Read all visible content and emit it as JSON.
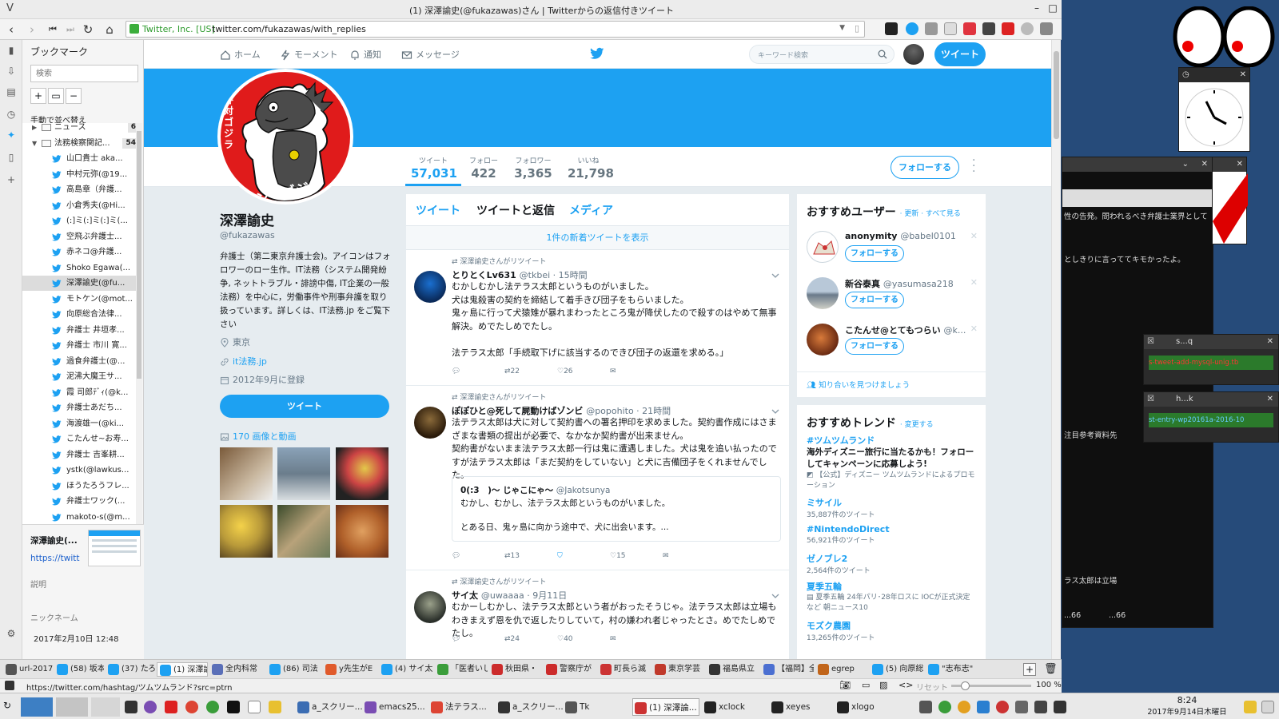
{
  "window": {
    "title": "(1) 深澤諭史(@fukazawas)さん | Twitterからの返信付きツイート",
    "menu_glyph": "V",
    "controls": {
      "minimize": "–",
      "maximize": "□",
      "close": "✕"
    }
  },
  "navbar": {
    "security_label": "Twitter, Inc. [US]",
    "url": "twitter.com/fukazawas/with_replies"
  },
  "sidebar": {
    "title": "ブックマーク",
    "search_placeholder": "検索",
    "sort_label": "手動で並べ替え",
    "tree": [
      {
        "label": "ニュース",
        "count": "6",
        "type": "folder",
        "expanded": false
      },
      {
        "label": "法務検察関記...",
        "count": "54",
        "type": "folder",
        "expanded": true
      },
      {
        "label": "山口貴士 aka..."
      },
      {
        "label": "中村元弥(@19..."
      },
      {
        "label": "高島章（弁護..."
      },
      {
        "label": "小倉秀夫(@Hi..."
      },
      {
        "label": "(:]ミ(:]ミ(:]ミ(..."
      },
      {
        "label": "空飛ぶ弁護士..."
      },
      {
        "label": "赤ネコ@弁護..."
      },
      {
        "label": "Shoko Egawa(..."
      },
      {
        "label": "深澤諭史(@fu...",
        "selected": true
      },
      {
        "label": "モトケン(@mot..."
      },
      {
        "label": "向原総合法律..."
      },
      {
        "label": "弁護士 井垣孝..."
      },
      {
        "label": "弁護士 市川 寛..."
      },
      {
        "label": "過食弁護士(@..."
      },
      {
        "label": "泥沸大魔王サ..."
      },
      {
        "label": "霞 司郎ﾃﾞｨ(@k..."
      },
      {
        "label": "弁護士あだち..."
      },
      {
        "label": "海渡雄一(@ki..."
      },
      {
        "label": "こたんせ~お寿..."
      },
      {
        "label": "弁護士 吉峯耕..."
      },
      {
        "label": "ystk(@lawkus..."
      },
      {
        "label": "ほうたろうフレ..."
      },
      {
        "label": "弁護士ワック(..."
      },
      {
        "label": "makoto-s(@m..."
      }
    ],
    "detail": {
      "name": "深澤諭史(...",
      "url": "https://twitt",
      "desc_label": "説明",
      "nick_label": "ニックネーム",
      "date": "2017年2月10日 12:48"
    }
  },
  "twitter_nav": {
    "home": "ホーム",
    "moments": "モーメント",
    "notifications": "通知",
    "messages": "メッセージ",
    "search_placeholder": "キーワード検索",
    "tweet_button": "ツイート"
  },
  "profile": {
    "avatar_text_vertical": "弁対ゴジラ",
    "avatar_text_bottom": "ベン・ゴジラ",
    "name": "深澤諭史",
    "handle": "@fukazawas",
    "bio": "弁護士（第二東京弁護士会)。アイコンはフォロワーのロー生作。IT法務（システム開発紛争, ネットトラブル・誹謗中傷, IT企業の一般法務）を中心に，労働事件や刑事弁護を取り扱っています。詳しくは、IT法務.jp をご覧下さい",
    "location": "東京",
    "website": "it法務.jp",
    "joined": "2012年9月に登録",
    "tweet_button": "ツイート",
    "media_link": "170 画像と動画",
    "stats": [
      {
        "label": "ツイート",
        "value": "57,031",
        "active": true
      },
      {
        "label": "フォロー",
        "value": "422"
      },
      {
        "label": "フォロワー",
        "value": "3,365"
      },
      {
        "label": "いいね",
        "value": "21,798"
      }
    ],
    "follow_button": "フォローする"
  },
  "timeline": {
    "tabs": [
      "ツイート",
      "ツイートと返信",
      "メディア"
    ],
    "active_tab": 1,
    "new_tweets": "1件の新着ツイートを表示",
    "tweets": [
      {
        "retweet_label": "深澤諭史さんがリツイート",
        "name": "とりとくLv631",
        "handle": "@tkbei · 15時間",
        "text": "むかしむかし法テラス太郎というものがいました。\n犬は鬼殺害の契約を締結して着手きび団子をもらいました。\n鬼ヶ島に行って犬猿雉が暴れまわったところ鬼が降伏したので殺すのはやめて無事解決。めでたしめでたし。\n\n法テラス太郎「手続取下げに該当するのできび団子の返還を求める。」",
        "reply": "",
        "retweets": "22",
        "likes": "26"
      },
      {
        "retweet_label": "深澤諭史さんがリツイート",
        "name": "ぽぽひと@死して屍動けばゾンビ",
        "handle": "@popohito · 21時間",
        "text": "法テラス太郎は犬に対して契約書への署名押印を求めました。契約書作成にはさまざまな書類の提出が必要で、なかなか契約書が出来ません。\n契約書がないまま法テラス太郎一行は鬼に遭遇しました。犬は鬼を追い払ったのですが法テラス太郎は「まだ契約をしていない」と犬に吉備団子をくれませんでした。",
        "quote_name": "0(:3　)〜 じゃこにゃ〜",
        "quote_handle": "@Jakotsunya",
        "quote_text": "むかし、むかし、法テラス太郎というものがいました。\n\nとある日、鬼ヶ島に向かう途中で、犬に出会います。...",
        "reply": "",
        "retweets": "13",
        "likes": "15"
      },
      {
        "retweet_label": "深澤諭史さんがリツイート",
        "name": "サイ太",
        "handle": "@uwaaaa · 9月11日",
        "text": "むかーしむかし、法テラス太郎という者がおったそうじゃ。法テラス太郎は立場もわきまえず恩を仇で返したりしていて，村の嫌われ者じゃったとさ。めでたしめでたし。",
        "reply": "",
        "retweets": "24",
        "likes": "40"
      }
    ]
  },
  "who_to_follow": {
    "title": "おすすめユーザー",
    "links": "· 更新 · すべて見る",
    "users": [
      {
        "name": "anonymity",
        "handle": "@babel0101",
        "follow": "フォローする"
      },
      {
        "name": "新谷泰真",
        "handle": "@yasumasa218",
        "follow": "フォローする"
      },
      {
        "name": "こたんせ@とてもつらい",
        "handle": "@k...",
        "follow": "フォローする"
      }
    ],
    "find_friends": "知り合いを見つけましょう"
  },
  "trends": {
    "title": "おすすめトレンド",
    "change": "· 変更する",
    "items": [
      {
        "tag": "#ツムツムランド",
        "desc": "海外ディズニー旅行に当たるかも！フォローしてキャンペーンに応募しよう!",
        "count": "【公式】ディズニー ツムツムランドによるプロモーション"
      },
      {
        "tag": "ミサイル",
        "desc": "",
        "count": "35,887件のツイート"
      },
      {
        "tag": "#NintendoDirect",
        "desc": "",
        "count": "56,921件のツイート"
      },
      {
        "tag": "ゼノブレ2",
        "desc": "",
        "count": "2,564件のツイート"
      },
      {
        "tag": "夏季五輪",
        "desc": "夏季五輪 24年パリ･28年ロスに IOCが正式決定 など 朝ニュース10",
        "count": ""
      },
      {
        "tag": "モズク農園",
        "desc": "",
        "count": "13,265件のツイート"
      }
    ]
  },
  "browser_tabs": [
    {
      "label": "url-2017-",
      "color": "#555"
    },
    {
      "label": "(58) 坂本",
      "color": "#1da1f2"
    },
    {
      "label": "(37) たろ",
      "color": "#1da1f2"
    },
    {
      "label": "(1) 深澤論",
      "color": "#1da1f2",
      "active": true
    },
    {
      "label": "全内科常",
      "color": "#5a6fb8"
    },
    {
      "label": "(86) 司法",
      "color": "#1da1f2"
    },
    {
      "label": "y先生がE",
      "color": "#e05a2b"
    },
    {
      "label": "(4) サイ太",
      "color": "#1da1f2"
    },
    {
      "label": "「医者いし",
      "color": "#3a9d3a"
    },
    {
      "label": "秋田県・",
      "color": "#cc2b2b"
    },
    {
      "label": "警察庁が",
      "color": "#cc2b2b"
    },
    {
      "label": "町長ら滅",
      "color": "#c33"
    },
    {
      "label": "東京学芸",
      "color": "#c0392b"
    },
    {
      "label": "福島県立",
      "color": "#333"
    },
    {
      "label": "【福岡】全",
      "color": "#4b6fd1"
    },
    {
      "label": "egrep",
      "color": "#c1651a"
    },
    {
      "label": "(5) 向原総",
      "color": "#1da1f2"
    },
    {
      "label": "\"志布志\"",
      "color": "#1da1f2"
    }
  ],
  "statusbar": {
    "link": "https://twitter.com/hashtag/ツムツムランド?src=ptrn",
    "reset": "リセット",
    "zoom": "100 %"
  },
  "taskbar": {
    "items": [
      {
        "label": "a_スクリー...",
        "color": "#3b6db3"
      },
      {
        "label": "emacs25...",
        "color": "#7a4db3"
      },
      {
        "label": "法テラス...",
        "color": "#dd4433"
      },
      {
        "label": "a_スクリー...",
        "color": "#333"
      },
      {
        "label": "Tk",
        "color": "#555"
      },
      {
        "label": "(1) 深澤論...",
        "color": "#cc3333"
      },
      {
        "label": "xclock",
        "color": "#222"
      },
      {
        "label": "xeyes",
        "color": "#222"
      },
      {
        "label": "xlogo",
        "color": "#222"
      }
    ],
    "clock_time": "8:24",
    "clock_date": "2017年9月14日木曜日"
  },
  "desktop": {
    "term1_text": "性の告発。問われるべき弁護士業界として",
    "term1_text2": "としきりに言っててキモかったよ。",
    "win_sq": "s...q",
    "win_hk": "h...k",
    "sq_text": "s-tweet-add-mysql-unig.tb",
    "hk_text": "st-entry-wp20161a-2016-10",
    "side_text": "注目参考資料先",
    "side_text2": "ラス太郎は立場",
    "tail1": "...66",
    "tail2": "...66"
  }
}
